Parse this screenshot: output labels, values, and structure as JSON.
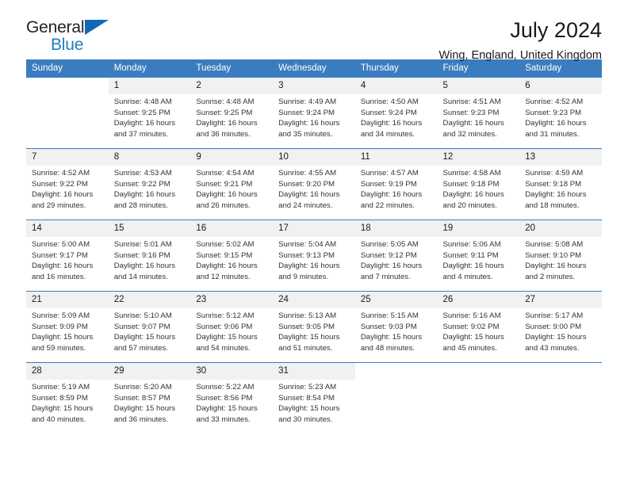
{
  "brand": {
    "name_part1": "General",
    "name_part2": "Blue",
    "triangle_icon": "triangle-icon",
    "color_dark": "#231f20",
    "color_blue": "#1f7ec4"
  },
  "header": {
    "title": "July 2024",
    "subtitle": "Wing, England, United Kingdom"
  },
  "colors": {
    "header_row_bg": "#3a7cc0",
    "daynum_bg": "#f1f1f1",
    "text": "#1a1a1a"
  },
  "weekday_headers": [
    "Sunday",
    "Monday",
    "Tuesday",
    "Wednesday",
    "Thursday",
    "Friday",
    "Saturday"
  ],
  "weeks": [
    [
      {
        "day": "",
        "sunrise": "",
        "sunset": "",
        "daylight_line1": "",
        "daylight_line2": ""
      },
      {
        "day": "1",
        "sunrise": "Sunrise: 4:48 AM",
        "sunset": "Sunset: 9:25 PM",
        "daylight_line1": "Daylight: 16 hours",
        "daylight_line2": "and 37 minutes."
      },
      {
        "day": "2",
        "sunrise": "Sunrise: 4:48 AM",
        "sunset": "Sunset: 9:25 PM",
        "daylight_line1": "Daylight: 16 hours",
        "daylight_line2": "and 36 minutes."
      },
      {
        "day": "3",
        "sunrise": "Sunrise: 4:49 AM",
        "sunset": "Sunset: 9:24 PM",
        "daylight_line1": "Daylight: 16 hours",
        "daylight_line2": "and 35 minutes."
      },
      {
        "day": "4",
        "sunrise": "Sunrise: 4:50 AM",
        "sunset": "Sunset: 9:24 PM",
        "daylight_line1": "Daylight: 16 hours",
        "daylight_line2": "and 34 minutes."
      },
      {
        "day": "5",
        "sunrise": "Sunrise: 4:51 AM",
        "sunset": "Sunset: 9:23 PM",
        "daylight_line1": "Daylight: 16 hours",
        "daylight_line2": "and 32 minutes."
      },
      {
        "day": "6",
        "sunrise": "Sunrise: 4:52 AM",
        "sunset": "Sunset: 9:23 PM",
        "daylight_line1": "Daylight: 16 hours",
        "daylight_line2": "and 31 minutes."
      }
    ],
    [
      {
        "day": "7",
        "sunrise": "Sunrise: 4:52 AM",
        "sunset": "Sunset: 9:22 PM",
        "daylight_line1": "Daylight: 16 hours",
        "daylight_line2": "and 29 minutes."
      },
      {
        "day": "8",
        "sunrise": "Sunrise: 4:53 AM",
        "sunset": "Sunset: 9:22 PM",
        "daylight_line1": "Daylight: 16 hours",
        "daylight_line2": "and 28 minutes."
      },
      {
        "day": "9",
        "sunrise": "Sunrise: 4:54 AM",
        "sunset": "Sunset: 9:21 PM",
        "daylight_line1": "Daylight: 16 hours",
        "daylight_line2": "and 26 minutes."
      },
      {
        "day": "10",
        "sunrise": "Sunrise: 4:55 AM",
        "sunset": "Sunset: 9:20 PM",
        "daylight_line1": "Daylight: 16 hours",
        "daylight_line2": "and 24 minutes."
      },
      {
        "day": "11",
        "sunrise": "Sunrise: 4:57 AM",
        "sunset": "Sunset: 9:19 PM",
        "daylight_line1": "Daylight: 16 hours",
        "daylight_line2": "and 22 minutes."
      },
      {
        "day": "12",
        "sunrise": "Sunrise: 4:58 AM",
        "sunset": "Sunset: 9:18 PM",
        "daylight_line1": "Daylight: 16 hours",
        "daylight_line2": "and 20 minutes."
      },
      {
        "day": "13",
        "sunrise": "Sunrise: 4:59 AM",
        "sunset": "Sunset: 9:18 PM",
        "daylight_line1": "Daylight: 16 hours",
        "daylight_line2": "and 18 minutes."
      }
    ],
    [
      {
        "day": "14",
        "sunrise": "Sunrise: 5:00 AM",
        "sunset": "Sunset: 9:17 PM",
        "daylight_line1": "Daylight: 16 hours",
        "daylight_line2": "and 16 minutes."
      },
      {
        "day": "15",
        "sunrise": "Sunrise: 5:01 AM",
        "sunset": "Sunset: 9:16 PM",
        "daylight_line1": "Daylight: 16 hours",
        "daylight_line2": "and 14 minutes."
      },
      {
        "day": "16",
        "sunrise": "Sunrise: 5:02 AM",
        "sunset": "Sunset: 9:15 PM",
        "daylight_line1": "Daylight: 16 hours",
        "daylight_line2": "and 12 minutes."
      },
      {
        "day": "17",
        "sunrise": "Sunrise: 5:04 AM",
        "sunset": "Sunset: 9:13 PM",
        "daylight_line1": "Daylight: 16 hours",
        "daylight_line2": "and 9 minutes."
      },
      {
        "day": "18",
        "sunrise": "Sunrise: 5:05 AM",
        "sunset": "Sunset: 9:12 PM",
        "daylight_line1": "Daylight: 16 hours",
        "daylight_line2": "and 7 minutes."
      },
      {
        "day": "19",
        "sunrise": "Sunrise: 5:06 AM",
        "sunset": "Sunset: 9:11 PM",
        "daylight_line1": "Daylight: 16 hours",
        "daylight_line2": "and 4 minutes."
      },
      {
        "day": "20",
        "sunrise": "Sunrise: 5:08 AM",
        "sunset": "Sunset: 9:10 PM",
        "daylight_line1": "Daylight: 16 hours",
        "daylight_line2": "and 2 minutes."
      }
    ],
    [
      {
        "day": "21",
        "sunrise": "Sunrise: 5:09 AM",
        "sunset": "Sunset: 9:09 PM",
        "daylight_line1": "Daylight: 15 hours",
        "daylight_line2": "and 59 minutes."
      },
      {
        "day": "22",
        "sunrise": "Sunrise: 5:10 AM",
        "sunset": "Sunset: 9:07 PM",
        "daylight_line1": "Daylight: 15 hours",
        "daylight_line2": "and 57 minutes."
      },
      {
        "day": "23",
        "sunrise": "Sunrise: 5:12 AM",
        "sunset": "Sunset: 9:06 PM",
        "daylight_line1": "Daylight: 15 hours",
        "daylight_line2": "and 54 minutes."
      },
      {
        "day": "24",
        "sunrise": "Sunrise: 5:13 AM",
        "sunset": "Sunset: 9:05 PM",
        "daylight_line1": "Daylight: 15 hours",
        "daylight_line2": "and 51 minutes."
      },
      {
        "day": "25",
        "sunrise": "Sunrise: 5:15 AM",
        "sunset": "Sunset: 9:03 PM",
        "daylight_line1": "Daylight: 15 hours",
        "daylight_line2": "and 48 minutes."
      },
      {
        "day": "26",
        "sunrise": "Sunrise: 5:16 AM",
        "sunset": "Sunset: 9:02 PM",
        "daylight_line1": "Daylight: 15 hours",
        "daylight_line2": "and 45 minutes."
      },
      {
        "day": "27",
        "sunrise": "Sunrise: 5:17 AM",
        "sunset": "Sunset: 9:00 PM",
        "daylight_line1": "Daylight: 15 hours",
        "daylight_line2": "and 43 minutes."
      }
    ],
    [
      {
        "day": "28",
        "sunrise": "Sunrise: 5:19 AM",
        "sunset": "Sunset: 8:59 PM",
        "daylight_line1": "Daylight: 15 hours",
        "daylight_line2": "and 40 minutes."
      },
      {
        "day": "29",
        "sunrise": "Sunrise: 5:20 AM",
        "sunset": "Sunset: 8:57 PM",
        "daylight_line1": "Daylight: 15 hours",
        "daylight_line2": "and 36 minutes."
      },
      {
        "day": "30",
        "sunrise": "Sunrise: 5:22 AM",
        "sunset": "Sunset: 8:56 PM",
        "daylight_line1": "Daylight: 15 hours",
        "daylight_line2": "and 33 minutes."
      },
      {
        "day": "31",
        "sunrise": "Sunrise: 5:23 AM",
        "sunset": "Sunset: 8:54 PM",
        "daylight_line1": "Daylight: 15 hours",
        "daylight_line2": "and 30 minutes."
      },
      {
        "day": "",
        "sunrise": "",
        "sunset": "",
        "daylight_line1": "",
        "daylight_line2": ""
      },
      {
        "day": "",
        "sunrise": "",
        "sunset": "",
        "daylight_line1": "",
        "daylight_line2": ""
      },
      {
        "day": "",
        "sunrise": "",
        "sunset": "",
        "daylight_line1": "",
        "daylight_line2": ""
      }
    ]
  ]
}
